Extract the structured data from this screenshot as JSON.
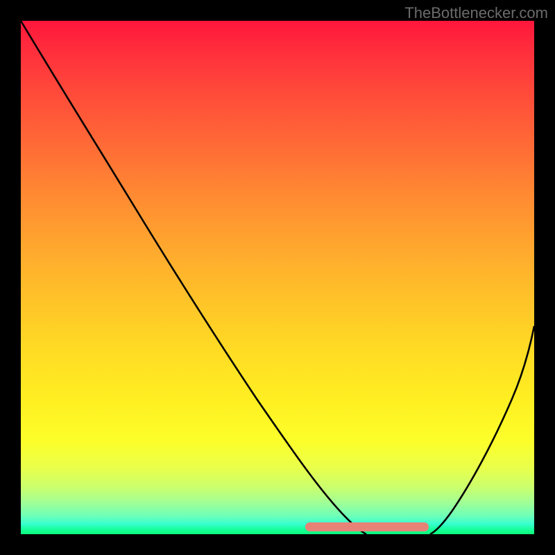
{
  "attribution": "TheBottlenecker.com",
  "chart_data": {
    "type": "line",
    "title": "",
    "xlabel": "",
    "ylabel": "",
    "xlim": [
      0,
      100
    ],
    "ylim": [
      0,
      100
    ],
    "series": [
      {
        "name": "left-curve",
        "x": [
          0,
          8,
          16,
          24,
          32,
          40,
          48,
          55,
          60,
          64,
          67
        ],
        "y": [
          100,
          88,
          76,
          63,
          50,
          37,
          24,
          13,
          6,
          2,
          0
        ]
      },
      {
        "name": "right-curve",
        "x": [
          80,
          83,
          86,
          89,
          92,
          95,
          98,
          100
        ],
        "y": [
          0,
          4,
          10,
          17,
          25,
          33,
          41,
          47
        ]
      }
    ],
    "flat_segment": {
      "x_start": 57,
      "x_end": 79,
      "y": 0.6,
      "color": "#e78277"
    },
    "gradient_stops": [
      {
        "pos": 0,
        "color": "#ff163b"
      },
      {
        "pos": 50,
        "color": "#ffb82c"
      },
      {
        "pos": 80,
        "color": "#fcff2a"
      },
      {
        "pos": 100,
        "color": "#0aff7a"
      }
    ]
  }
}
